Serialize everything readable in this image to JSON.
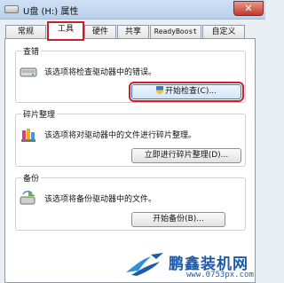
{
  "window": {
    "title": "U盘 (H:) 属性",
    "close_glyph": "✕"
  },
  "tabs": [
    {
      "label": "常规"
    },
    {
      "label": "工具"
    },
    {
      "label": "硬件"
    },
    {
      "label": "共享"
    },
    {
      "label": "ReadyBoost"
    },
    {
      "label": "自定义"
    }
  ],
  "active_tab": "工具",
  "groups": {
    "error_check": {
      "label": "查错",
      "description": "该选项将检查驱动器中的错误。",
      "button": "开始检查(C)..."
    },
    "defrag": {
      "label": "碎片整理",
      "description": "该选项将对驱动器中的文件进行碎片整理。",
      "button": "立即进行碎片整理(D)..."
    },
    "backup": {
      "label": "备份",
      "description": "该选项将备份驱动器中的文件。",
      "button": "开始备份(B)..."
    }
  },
  "watermark": {
    "name": "鹏鑫装机网",
    "url": "www.0753px.com"
  },
  "colors": {
    "highlight": "#c8202a",
    "brand": "#1d5aa8"
  }
}
